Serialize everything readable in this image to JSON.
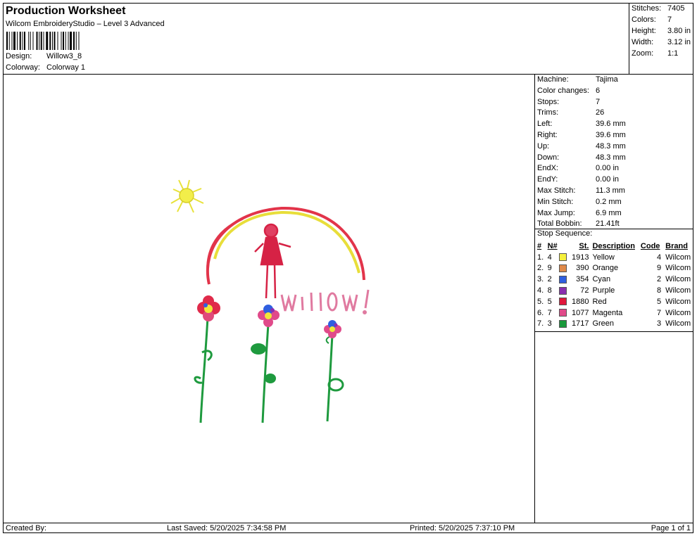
{
  "header": {
    "title": "Production Worksheet",
    "subtitle": "Wilcom EmbroideryStudio – Level 3 Advanced",
    "design_label": "Design:",
    "design_value": "Willow3_8",
    "colorway_label": "Colorway:",
    "colorway_value": "Colorway 1"
  },
  "summary": [
    {
      "label": "Stitches:",
      "value": "7405"
    },
    {
      "label": "Colors:",
      "value": "7"
    },
    {
      "label": "Height:",
      "value": "3.80 in"
    },
    {
      "label": "Width:",
      "value": "3.12 in"
    },
    {
      "label": "Zoom:",
      "value": "1:1"
    }
  ],
  "machine_info": [
    {
      "label": "Machine:",
      "value": "Tajima"
    },
    {
      "label": "Color changes:",
      "value": "6"
    },
    {
      "label": "Stops:",
      "value": "7"
    },
    {
      "label": "Trims:",
      "value": "26"
    },
    {
      "label": "Left:",
      "value": "39.6 mm"
    },
    {
      "label": "Right:",
      "value": "39.6 mm"
    },
    {
      "label": "Up:",
      "value": "48.3 mm"
    },
    {
      "label": "Down:",
      "value": "48.3 mm"
    },
    {
      "label": "EndX:",
      "value": "0.00 in"
    },
    {
      "label": "EndY:",
      "value": "0.00 in"
    },
    {
      "label": "Max Stitch:",
      "value": "11.3 mm"
    },
    {
      "label": "Min Stitch:",
      "value": "0.2 mm"
    },
    {
      "label": "Max Jump:",
      "value": "6.9 mm"
    },
    {
      "label": "Total Bobbin:",
      "value": "21.41ft"
    }
  ],
  "stop_sequence": {
    "title": "Stop Sequence:",
    "columns": [
      "#",
      "N#",
      "St.",
      "Description",
      "Code",
      "Brand"
    ],
    "rows": [
      {
        "num": "1.",
        "n": "4",
        "color": "#f5f03c",
        "st": "1913",
        "desc": "Yellow",
        "code": "4",
        "brand": "Wilcom"
      },
      {
        "num": "2.",
        "n": "9",
        "color": "#e08a4a",
        "st": "390",
        "desc": "Orange",
        "code": "9",
        "brand": "Wilcom"
      },
      {
        "num": "3.",
        "n": "2",
        "color": "#2f5fe0",
        "st": "354",
        "desc": "Cyan",
        "code": "2",
        "brand": "Wilcom"
      },
      {
        "num": "4.",
        "n": "8",
        "color": "#8a2fb0",
        "st": "72",
        "desc": "Purple",
        "code": "8",
        "brand": "Wilcom"
      },
      {
        "num": "5.",
        "n": "5",
        "color": "#e0183c",
        "st": "1880",
        "desc": "Red",
        "code": "5",
        "brand": "Wilcom"
      },
      {
        "num": "6.",
        "n": "7",
        "color": "#e04a8a",
        "st": "1077",
        "desc": "Magenta",
        "code": "7",
        "brand": "Wilcom"
      },
      {
        "num": "7.",
        "n": "3",
        "color": "#1a9a3c",
        "st": "1717",
        "desc": "Green",
        "code": "3",
        "brand": "Wilcom"
      }
    ]
  },
  "footer": {
    "created_by": "Created By:",
    "last_saved": "Last Saved: 5/20/2025 7:34:58 PM",
    "printed": "Printed: 5/20/2025 7:37:10 PM",
    "page": "Page 1 of 1"
  },
  "design_text": "WILLOW"
}
